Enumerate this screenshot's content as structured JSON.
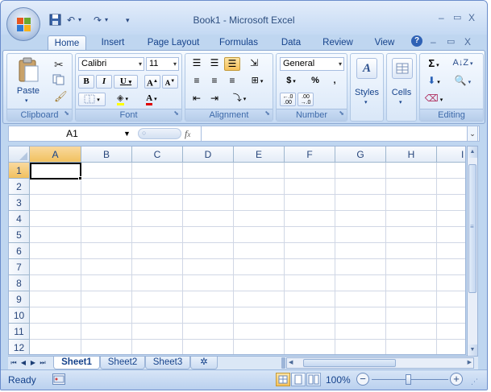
{
  "window": {
    "title": "Book1 - Microsoft Excel",
    "min": "–",
    "max": "▭",
    "close": "X"
  },
  "qat": {
    "save_icon": "save-icon",
    "undo": "↶",
    "redo": "↷",
    "customize": "▾"
  },
  "tabs": [
    "Home",
    "Insert",
    "Page Layout",
    "Formulas",
    "Data",
    "Review",
    "View"
  ],
  "ribbon_ctl": {
    "help": "?",
    "min": "–",
    "restore": "▭",
    "close": "X"
  },
  "clipboard": {
    "paste": "Paste",
    "label": "Clipboard"
  },
  "font": {
    "name": "Calibri",
    "size": "11",
    "bold": "B",
    "italic": "I",
    "underline": "U",
    "grow": "A",
    "shrink": "A",
    "color_a": "A",
    "label": "Font"
  },
  "alignment": {
    "label": "Alignment"
  },
  "number": {
    "format": "General",
    "currency": "$",
    "percent": "%",
    "comma": ",",
    "inc": ".0 .00",
    "dec": ".00 ⟶.0",
    "label": "Number"
  },
  "styles": {
    "label": "Styles"
  },
  "cells": {
    "label": "Cells"
  },
  "editing": {
    "sum": "Σ",
    "label": "Editing"
  },
  "formula_bar": {
    "name_box": "A1",
    "fx": "fx",
    "expand": "⌄"
  },
  "columns": [
    "A",
    "B",
    "C",
    "D",
    "E",
    "F",
    "G",
    "H",
    "I"
  ],
  "rows": [
    "1",
    "2",
    "3",
    "4",
    "5",
    "6",
    "7",
    "8",
    "9",
    "10",
    "11",
    "12"
  ],
  "sheets": [
    "Sheet1",
    "Sheet2",
    "Sheet3"
  ],
  "status": {
    "ready": "Ready",
    "zoom": "100%",
    "zoom_out": "−",
    "zoom_in": "+"
  },
  "colors": {
    "accent": "#15428b",
    "selection": "#f6c15a",
    "frame": "#bfd6f0"
  }
}
